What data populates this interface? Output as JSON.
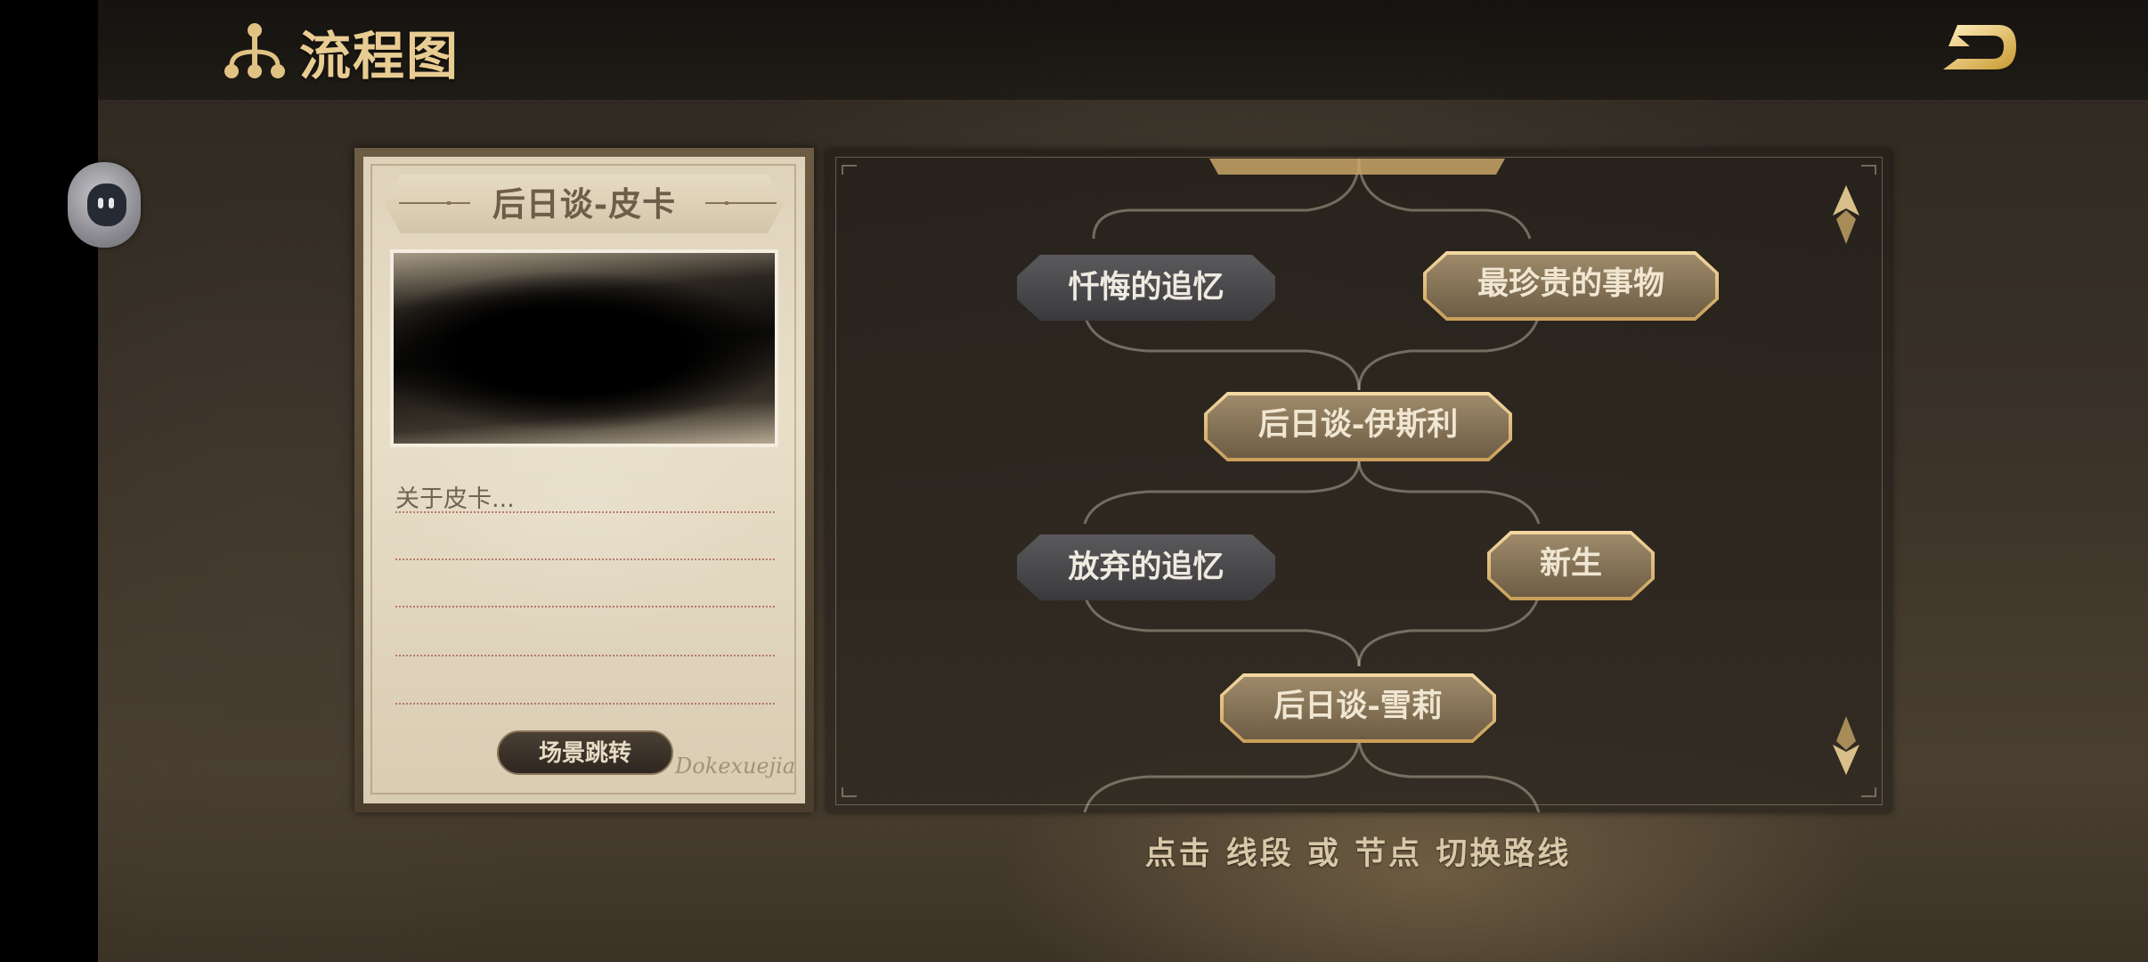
{
  "header": {
    "title": "流程图",
    "title_icon": "flowchart-icon",
    "back_icon": "return-arrow-icon",
    "accent": "#e8cc92"
  },
  "card": {
    "title": "后日谈-皮卡",
    "description": "关于皮卡...",
    "scene_button_label": "场景跳转",
    "signature": "Dokexuejia"
  },
  "flow": {
    "nodes": {
      "regret_memory": "忏悔的追忆",
      "precious_thing": "最珍贵的事物",
      "epilogue_isley": "后日谈-伊斯利",
      "abandoned_memory": "放弃的追忆",
      "rebirth": "新生",
      "epilogue_shelly": "后日谈-雪莉"
    },
    "scroll_up_icon": "scroll-up-arrow-icon",
    "scroll_down_icon": "scroll-down-arrow-icon"
  },
  "footer": {
    "hint": "点击 线段 或 节点 切换路线"
  }
}
